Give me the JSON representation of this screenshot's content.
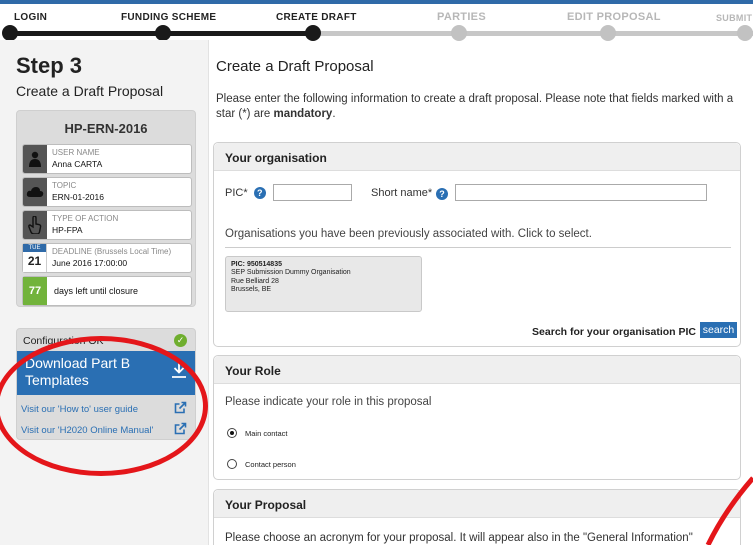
{
  "wizard": {
    "steps": [
      {
        "label": "LOGIN",
        "state": "done"
      },
      {
        "label": "FUNDING SCHEME",
        "state": "done"
      },
      {
        "label": "CREATE DRAFT",
        "state": "current"
      },
      {
        "label": "PARTIES",
        "state": "todo"
      },
      {
        "label": "EDIT PROPOSAL",
        "state": "todo"
      },
      {
        "label": "SUBMIT",
        "state": "todo"
      }
    ]
  },
  "sidebar": {
    "step_title": "Step 3",
    "step_subtitle": "Create a Draft Proposal",
    "card": {
      "title": "HP-ERN-2016",
      "user_label": "USER NAME",
      "user_value": "Anna CARTA",
      "topic_label": "TOPIC",
      "topic_value": "ERN-01-2016",
      "action_label": "TYPE OF ACTION",
      "action_value": "HP-FPA",
      "deadline_day": "TUE",
      "deadline_date": "21",
      "deadline_label": "DEADLINE (Brussels Local Time)",
      "deadline_value": "June 2016 17:00:00",
      "days_left": "77",
      "days_text": "days left until closure"
    },
    "tools": {
      "config": "Configuration OK",
      "download": "Download Part B Templates",
      "howto": "Visit our 'How to' user guide",
      "manual": "Visit our 'H2020 Online Manual'"
    }
  },
  "main": {
    "title": "Create a Draft Proposal",
    "intro": "Please enter the following information to create a draft proposal. Please note that fields marked with a star (*) are",
    "intro_bold": "mandatory",
    "organisation": {
      "heading": "Your organisation",
      "pic_label": "PIC*",
      "short_name_label": "Short name*",
      "pic_value": "",
      "short_name_value": "",
      "associated_text": "Organisations you have been previously associated with. Click to select.",
      "org_pic": "PIC: 950514835",
      "org_name": "SEP Submission Dummy Organisation",
      "org_street": "Rue Belliard 28",
      "org_city": "Brussels, BE",
      "search_label": "Search for your organisation PIC",
      "search_button": "search"
    },
    "role": {
      "heading": "Your Role",
      "question": "Please indicate your role in this proposal",
      "options": [
        "Main contact",
        "Contact person"
      ],
      "selected": "Main contact"
    },
    "proposal": {
      "heading": "Your Proposal",
      "text": "Please choose an acronym for your proposal. It will appear also in the \"General Information\""
    }
  },
  "colors": {
    "accent": "#2a6fb3",
    "annotation": "#e4161a",
    "days_badge": "#72b33b"
  }
}
